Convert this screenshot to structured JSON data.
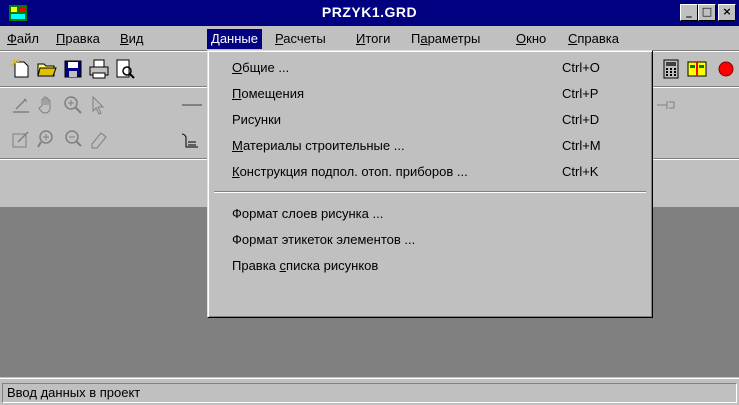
{
  "window": {
    "title": "PRZYK1.GRD",
    "buttons": {
      "minimize": "_",
      "maximize": "□",
      "close": "×"
    }
  },
  "menubar": {
    "items": [
      {
        "pre": "",
        "u": "Ф",
        "post": "айл"
      },
      {
        "pre": "",
        "u": "П",
        "post": "равка"
      },
      {
        "pre": "",
        "u": "В",
        "post": "ид"
      },
      {
        "pre": "",
        "u": "Д",
        "post": "анные"
      },
      {
        "pre": "",
        "u": "Р",
        "post": "асчеты"
      },
      {
        "pre": "",
        "u": "И",
        "post": "тоги"
      },
      {
        "pre": "П",
        "u": "а",
        "post": "раметры"
      },
      {
        "pre": "",
        "u": "О",
        "post": "кно"
      },
      {
        "pre": "",
        "u": "С",
        "post": "правка"
      }
    ]
  },
  "dropdown": {
    "items": [
      {
        "pre": "",
        "u": "О",
        "post": "бщие ...",
        "shortcut": "Ctrl+O"
      },
      {
        "pre": "",
        "u": "П",
        "post": "омещения",
        "shortcut": "Ctrl+P"
      },
      {
        "pre": "Рисунки",
        "u": "",
        "post": "",
        "shortcut": "Ctrl+D"
      },
      {
        "pre": "",
        "u": "М",
        "post": "атериалы строительные ...",
        "shortcut": "Ctrl+M"
      },
      {
        "pre": "",
        "u": "К",
        "post": "онструкция подпол. отоп. приборов ...",
        "shortcut": "Ctrl+K"
      },
      {
        "pre": "Формат слоев рисунка ...",
        "u": "",
        "post": "",
        "shortcut": ""
      },
      {
        "pre": "Формат этикеток элементов ...",
        "u": "",
        "post": "",
        "shortcut": ""
      },
      {
        "pre": "Правка ",
        "u": "с",
        "post": "писка рисунков",
        "shortcut": ""
      }
    ]
  },
  "toolbar_icons": [
    "new-file-icon",
    "open-folder-icon",
    "save-icon",
    "print-icon",
    "print-preview-icon",
    "calculator-icon",
    "split-view-icon",
    "draw-line-icon",
    "hand-pan-icon",
    "zoom-icon",
    "pointer-icon",
    "edit-element-icon",
    "zoom-in-icon",
    "zoom-out-icon",
    "eraser-icon",
    "layer-icon"
  ],
  "statusbar": {
    "text": "Ввод данных в проект"
  }
}
